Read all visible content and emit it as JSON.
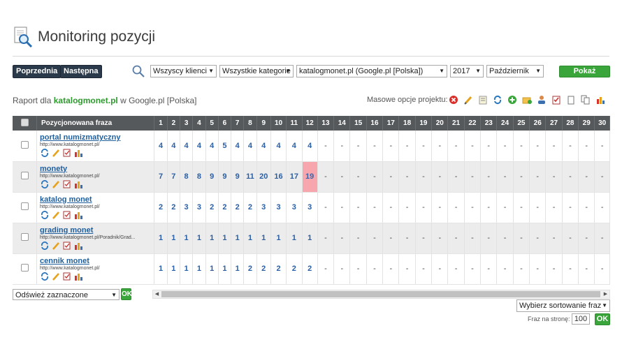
{
  "page": {
    "title": "Monitoring pozycji",
    "title_icon": "magnifier-document-icon"
  },
  "toolbar": {
    "prev_label": "Poprzednia",
    "next_label": "Następna",
    "search_icon": "search-icon",
    "client_select": "Wszyscy klienci",
    "category_select": "Wszystkie kategorie",
    "project_select": "katalogmonet.pl (Google.pl [Polska])",
    "year_select": "2017",
    "month_select": "Październik",
    "show_report_label": "Pokaż raport"
  },
  "report": {
    "prefix": "Raport dla",
    "domain": "katalogmonet.pl",
    "suffix": "w Google.pl [Polska]",
    "mass_options_label": "Masowe opcje projektu:",
    "mass_icons": [
      "delete-icon",
      "edit-icon",
      "notes-icon",
      "refresh-icon",
      "add-icon",
      "add-folder-icon",
      "user-icon",
      "checklist-icon",
      "copy-icon",
      "duplicate-icon",
      "chart-icon"
    ]
  },
  "table": {
    "phrase_header": "Pozycjonowana fraza",
    "days": [
      "1",
      "2",
      "3",
      "4",
      "5",
      "6",
      "7",
      "8",
      "9",
      "10",
      "11",
      "12",
      "13",
      "14",
      "15",
      "16",
      "17",
      "18",
      "19",
      "20",
      "21",
      "22",
      "23",
      "24",
      "25",
      "26",
      "27",
      "28",
      "29",
      "30"
    ],
    "rows": [
      {
        "phrase": "portal numizmatyczny",
        "url": "http://www.katalogmonet.pl/",
        "positions": [
          "4",
          "4",
          "4",
          "4",
          "4",
          "5",
          "4",
          "4",
          "4",
          "4",
          "4",
          "4",
          "-",
          "-",
          "-",
          "-",
          "-",
          "-",
          "-",
          "-",
          "-",
          "-",
          "-",
          "-",
          "-",
          "-",
          "-",
          "-",
          "-",
          "-"
        ]
      },
      {
        "phrase": "monety",
        "url": "http://www.katalogmonet.pl/",
        "positions": [
          "7",
          "7",
          "8",
          "8",
          "9",
          "9",
          "9",
          "11",
          "20",
          "16",
          "17",
          "19",
          "-",
          "-",
          "-",
          "-",
          "-",
          "-",
          "-",
          "-",
          "-",
          "-",
          "-",
          "-",
          "-",
          "-",
          "-",
          "-",
          "-",
          "-"
        ],
        "highlight_day": 12
      },
      {
        "phrase": "katalog monet",
        "url": "http://www.katalogmonet.pl/",
        "positions": [
          "2",
          "2",
          "3",
          "3",
          "2",
          "2",
          "2",
          "2",
          "3",
          "3",
          "3",
          "3",
          "-",
          "-",
          "-",
          "-",
          "-",
          "-",
          "-",
          "-",
          "-",
          "-",
          "-",
          "-",
          "-",
          "-",
          "-",
          "-",
          "-",
          "-"
        ]
      },
      {
        "phrase": "grading monet",
        "url": "http://www.katalogmonet.pl/Poradnik/Grad...",
        "positions": [
          "1",
          "1",
          "1",
          "1",
          "1",
          "1",
          "1",
          "1",
          "1",
          "1",
          "1",
          "1",
          "-",
          "-",
          "-",
          "-",
          "-",
          "-",
          "-",
          "-",
          "-",
          "-",
          "-",
          "-",
          "-",
          "-",
          "-",
          "-",
          "-",
          "-"
        ]
      },
      {
        "phrase": "cennik monet",
        "url": "http://www.katalogmonet.pl/",
        "positions": [
          "1",
          "1",
          "1",
          "1",
          "1",
          "1",
          "1",
          "2",
          "2",
          "2",
          "2",
          "2",
          "-",
          "-",
          "-",
          "-",
          "-",
          "-",
          "-",
          "-",
          "-",
          "-",
          "-",
          "-",
          "-",
          "-",
          "-",
          "-",
          "-",
          "-"
        ]
      }
    ],
    "highlight_color": "#f7a6ad"
  },
  "footer": {
    "bulk_select": "Odśwież zaznaczone",
    "ok_label": "OK",
    "sort_select": "Wybierz sortowanie fraz",
    "per_page_label": "Fraz na stronę:",
    "per_page_value": "100"
  }
}
